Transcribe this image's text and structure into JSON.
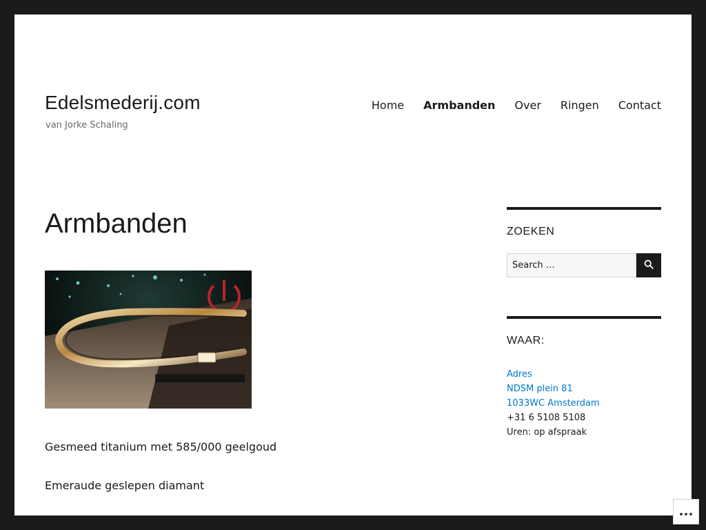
{
  "site": {
    "title": "Edelsmederij.com",
    "description": "van Jorke Schaling"
  },
  "nav": {
    "items": [
      {
        "label": "Home",
        "current": false
      },
      {
        "label": "Armbanden",
        "current": true
      },
      {
        "label": "Over",
        "current": false
      },
      {
        "label": "Ringen",
        "current": false
      },
      {
        "label": "Contact",
        "current": false
      }
    ]
  },
  "main": {
    "title": "Armbanden",
    "image_icon": "bracelet-photo",
    "paragraphs": [
      "Gesmeed titanium met 585/000 geelgoud",
      "Emeraude geslepen diamant"
    ]
  },
  "sidebar": {
    "search": {
      "title": "ZOEKEN",
      "placeholder": "Search …",
      "button_icon": "search-icon"
    },
    "where": {
      "title": "WAAR:",
      "links": [
        "Adres",
        "NDSM plein 81",
        "1033WC Amsterdam"
      ],
      "lines": [
        "+31 6 5108 5108",
        "Uren: op afspraak"
      ]
    }
  },
  "colors": {
    "background": "#1a1a1a",
    "page": "#ffffff",
    "text": "#1a1a1a",
    "link": "#007acc",
    "muted": "#686868"
  },
  "floating": {
    "more_icon": "ellipsis-icon"
  }
}
